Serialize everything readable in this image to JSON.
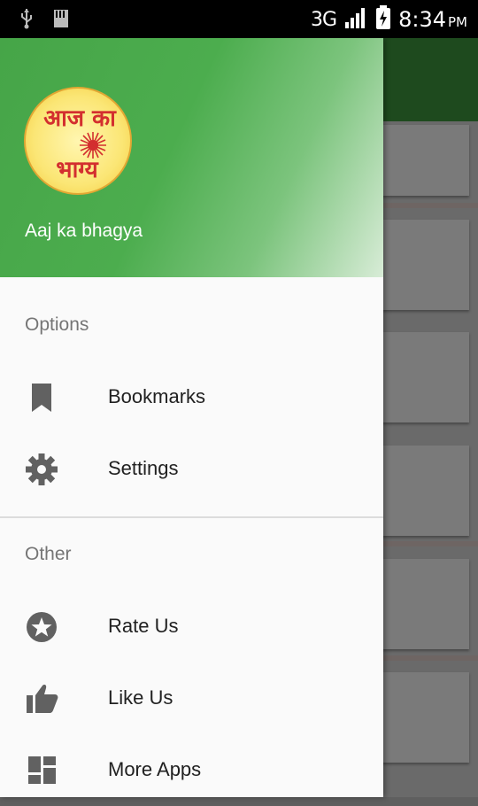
{
  "status_bar": {
    "network": "3G",
    "time": "8:34",
    "ampm": "PM"
  },
  "drawer": {
    "logo_text_line1": "आज का",
    "logo_text_line2": "भाग्य",
    "app_name": "Aaj ka bhagya",
    "sections": [
      {
        "title": "Options",
        "items": [
          {
            "label": "Bookmarks",
            "icon": "bookmark-icon"
          },
          {
            "label": "Settings",
            "icon": "gear-icon"
          }
        ]
      },
      {
        "title": "Other",
        "items": [
          {
            "label": "Rate Us",
            "icon": "star-circle-icon"
          },
          {
            "label": "Like Us",
            "icon": "thumbs-up-icon"
          },
          {
            "label": "More Apps",
            "icon": "apps-grid-icon"
          }
        ]
      }
    ]
  },
  "colors": {
    "header_green": "#4cad4e",
    "toolbar_dark_green": "#1e4a1e",
    "logo_red": "#d32f2f",
    "icon_gray": "#616161"
  }
}
